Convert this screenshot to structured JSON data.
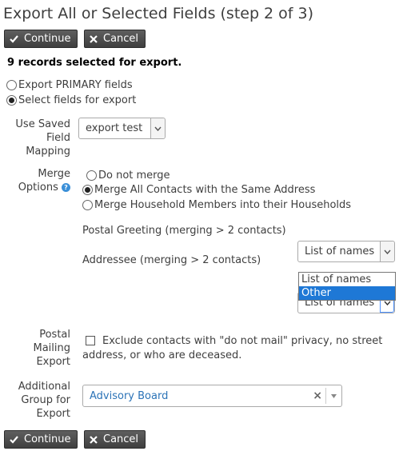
{
  "title": "Export All or Selected Fields (step 2 of 3)",
  "buttons": {
    "continue": "Continue",
    "cancel": "Cancel"
  },
  "status": "9 records selected for export.",
  "export_mode": {
    "options": [
      "Export PRIMARY fields",
      "Select fields for export"
    ],
    "selected": "Select fields for export"
  },
  "saved_mapping": {
    "label_lines": [
      "Use Saved",
      "Field",
      "Mapping"
    ],
    "value": "export test"
  },
  "merge": {
    "label_lines": [
      "Merge",
      "Options"
    ],
    "options": [
      "Do not merge",
      "Merge All Contacts with the Same Address",
      "Merge Household Members into their Households"
    ],
    "selected": "Merge All Contacts with the Same Address"
  },
  "postal_greeting": {
    "label": "Postal Greeting (merging > 2 contacts)",
    "value": "List of names"
  },
  "addressee": {
    "label": "Addressee (merging > 2 contacts)",
    "value": "List of names",
    "dropdown_options": [
      "List of names",
      "Other"
    ],
    "highlighted": "Other"
  },
  "postal_mailing": {
    "label_lines": [
      "Postal",
      "Mailing",
      "Export"
    ],
    "checkbox_line1": "Exclude contacts with \"do not mail\" privacy, no street",
    "checkbox_line2": "address, or who are deceased."
  },
  "additional_group": {
    "label_lines": [
      "Additional",
      "Group for",
      "Export"
    ],
    "value": "Advisory Board"
  },
  "colors": {
    "button_bg": "#4a4a4a",
    "link_blue": "#2b73b7",
    "highlight": "#1e78d6"
  }
}
